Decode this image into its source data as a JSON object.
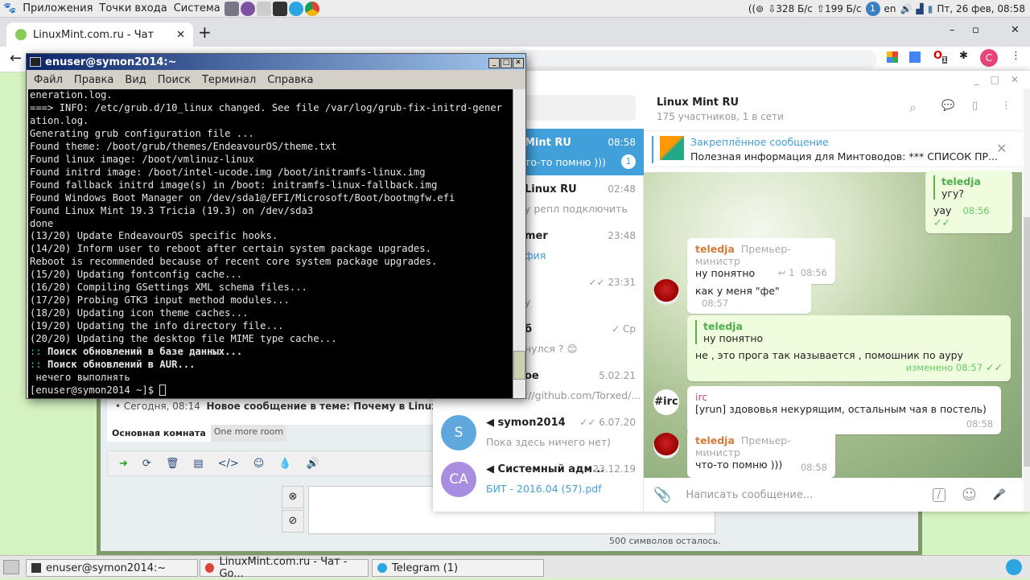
{
  "panel": {
    "menus": [
      "Приложения",
      "Точки входа",
      "Система"
    ],
    "net_down": "328 Б/с",
    "net_up": "199 Б/с",
    "notif_count": "1",
    "lang": "en",
    "clock": "Пт, 26 фев, 08:58"
  },
  "browser": {
    "tab_title": "LinuxMint.com.ru - Чат",
    "ext_badge": "1",
    "profile": "C"
  },
  "site": {
    "news": "• Сегодня, 08:14",
    "news_title": "Новое сообщение в теме: Почему в Linux Mint 20",
    "rooms": [
      "Основная комната",
      "One more room"
    ],
    "chars_left": "500 символов осталось."
  },
  "terminal": {
    "title": "enuser@symon2014:~",
    "menu": [
      "Файл",
      "Правка",
      "Вид",
      "Поиск",
      "Терминал",
      "Справка"
    ],
    "lines": [
      "eneration.log.",
      "===> INFO: /etc/grub.d/10_linux changed. See file /var/log/grub-fix-initrd-gener",
      "ation.log.",
      "Generating grub configuration file ...",
      "Found theme: /boot/grub/themes/EndeavourOS/theme.txt",
      "Found linux image: /boot/vmlinuz-linux",
      "Found initrd image: /boot/intel-ucode.img /boot/initramfs-linux.img",
      "Found fallback initrd image(s) in /boot: initramfs-linux-fallback.img",
      "Found Windows Boot Manager on /dev/sda1@/EFI/Microsoft/Boot/bootmgfw.efi",
      "Found Linux Mint 19.3 Tricia (19.3) on /dev/sda3",
      "done",
      "(13/20) Update EndeavourOS specific hooks.",
      "(14/20) Inform user to reboot after certain system package upgrades.",
      "Reboot is recommended because of recent core system package upgrades.",
      "(15/20) Updating fontconfig cache...",
      "(16/20) Compiling GSettings XML schema files...",
      "(17/20) Probing GTK3 input method modules...",
      "(18/20) Updating icon theme caches...",
      "(19/20) Updating the info directory file...",
      "(20/20) Updating the desktop file MIME type cache..."
    ],
    "search_db": "Поиск обновлений в базе данных...",
    "search_aur": "Поиск обновлений в AUR...",
    "nothing": " нечего выполнять",
    "prompt": "[enuser@symon2014 ~]$ "
  },
  "telegram": {
    "chats": [
      {
        "name": "Mint RU",
        "time": "08:58",
        "preview": "то-то помню )))",
        "badge": "1",
        "active": true
      },
      {
        "name": "Linux RU",
        "time": "02:48",
        "preview": "у репл подключить"
      },
      {
        "name": "mer",
        "time": "23:48",
        "preview": "фия"
      },
      {
        "name": "",
        "time": "✓✓ 23:31",
        "preview": "у"
      },
      {
        "name": "б",
        "time": "✓ Ср",
        "preview": "нулся ? 😊"
      },
      {
        "name": "ое",
        "time": "5.02.21",
        "preview": "://github.com/Torxed/..."
      },
      {
        "name": "symon2014",
        "time": "✓✓ 6.07.20",
        "preview": "Пока здесь ничего нет)",
        "avatar": "S",
        "avatar_color": "#5ea8dd"
      },
      {
        "name": "Системный адм...",
        "time": "23.12.19",
        "preview": "БИТ - 2016.04 (57).pdf",
        "avatar": "CA",
        "avatar_color": "#a88de0"
      }
    ],
    "chat_title": "Linux Mint RU",
    "chat_status": "175 участников, 1 в сети",
    "pinned_label": "Закреплённое сообщение",
    "pinned_text": "Полезная информация для Минтоводов: *** СПИСОК ПР...",
    "messages": {
      "m1": {
        "quote_name": "teledja",
        "quote_text": "угу?",
        "text": "уay",
        "time": "08:56"
      },
      "m2": {
        "sender": "teledja",
        "role": "Премьер-министр",
        "text": "ну понятно",
        "replies": "1",
        "time": "08:56"
      },
      "m3": {
        "text": "как у меня \"фе\"",
        "time": "08:57"
      },
      "m4": {
        "quote_name": "teledja",
        "quote_text": "ну понятно",
        "text": "не , это прога так называется , помошник по ауру",
        "time": "изменено 08:57"
      },
      "m5": {
        "sender": "irc",
        "avatar": "#irc",
        "text": "[yrun] здововья некурящим, остальным чая в постель)",
        "time": "08:58"
      },
      "m6": {
        "sender": "teledja",
        "role": "Премьер-министр",
        "text": "что-то помню )))",
        "time": "08:58"
      }
    },
    "input_placeholder": "Написать сообщение...",
    "accent": "#419fd9"
  },
  "taskbar": {
    "items": [
      "enuser@symon2014:~",
      "LinuxMint.com.ru - Чат - Go...",
      "Telegram (1)"
    ]
  }
}
